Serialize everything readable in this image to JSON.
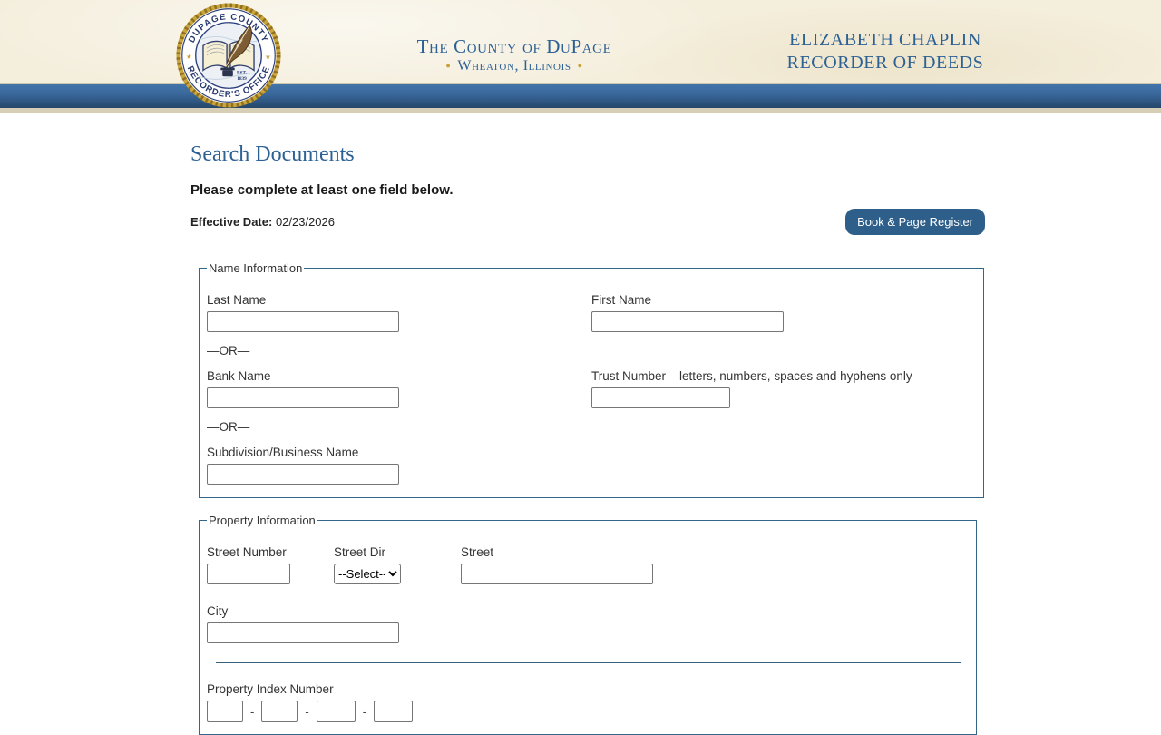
{
  "header": {
    "seal": {
      "top_text": "DUPAGE COUNTY",
      "bottom_text": "RECORDER'S OFFICE",
      "est_line1": "EST.",
      "est_line2": "1839"
    },
    "county_title": "The County of DuPage",
    "county_subtitle": "Wheaton, Illinois",
    "official_name": "ELIZABETH CHAPLIN",
    "official_title": "RECORDER OF DEEDS"
  },
  "page": {
    "title": "Search Documents",
    "instruction": "Please complete at least one field below.",
    "effective_date_label": "Effective Date:",
    "effective_date_value": "02/23/2026",
    "book_page_button_label": "Book & Page Register"
  },
  "name_information": {
    "legend": "Name Information",
    "last_name_label": "Last Name",
    "first_name_label": "First Name",
    "or_separator": "—OR—",
    "bank_name_label": "Bank Name",
    "trust_number_label": "Trust Number – letters, numbers, spaces and hyphens only",
    "subdivision_label": "Subdivision/Business Name",
    "last_name_value": "",
    "first_name_value": "",
    "bank_name_value": "",
    "trust_number_value": "",
    "subdivision_value": ""
  },
  "property_information": {
    "legend": "Property Information",
    "street_number_label": "Street Number",
    "street_dir_label": "Street Dir",
    "street_dir_selected": "--Select--",
    "street_label": "Street",
    "city_label": "City",
    "pin_label": "Property Index Number",
    "pin_separator": "-",
    "street_number_value": "",
    "street_value": "",
    "city_value": "",
    "pin_values": [
      "",
      "",
      "",
      ""
    ]
  },
  "colors": {
    "accent_blue": "#2d6194",
    "navbar_blue_top": "#4274aa",
    "navbar_blue_bottom": "#254669",
    "header_parchment": "#f4eedc",
    "tan_border": "#d6cfb6",
    "fieldset_border": "#336688",
    "button_blue": "#2d5f8a",
    "seal_gold": "#c9a23a"
  }
}
